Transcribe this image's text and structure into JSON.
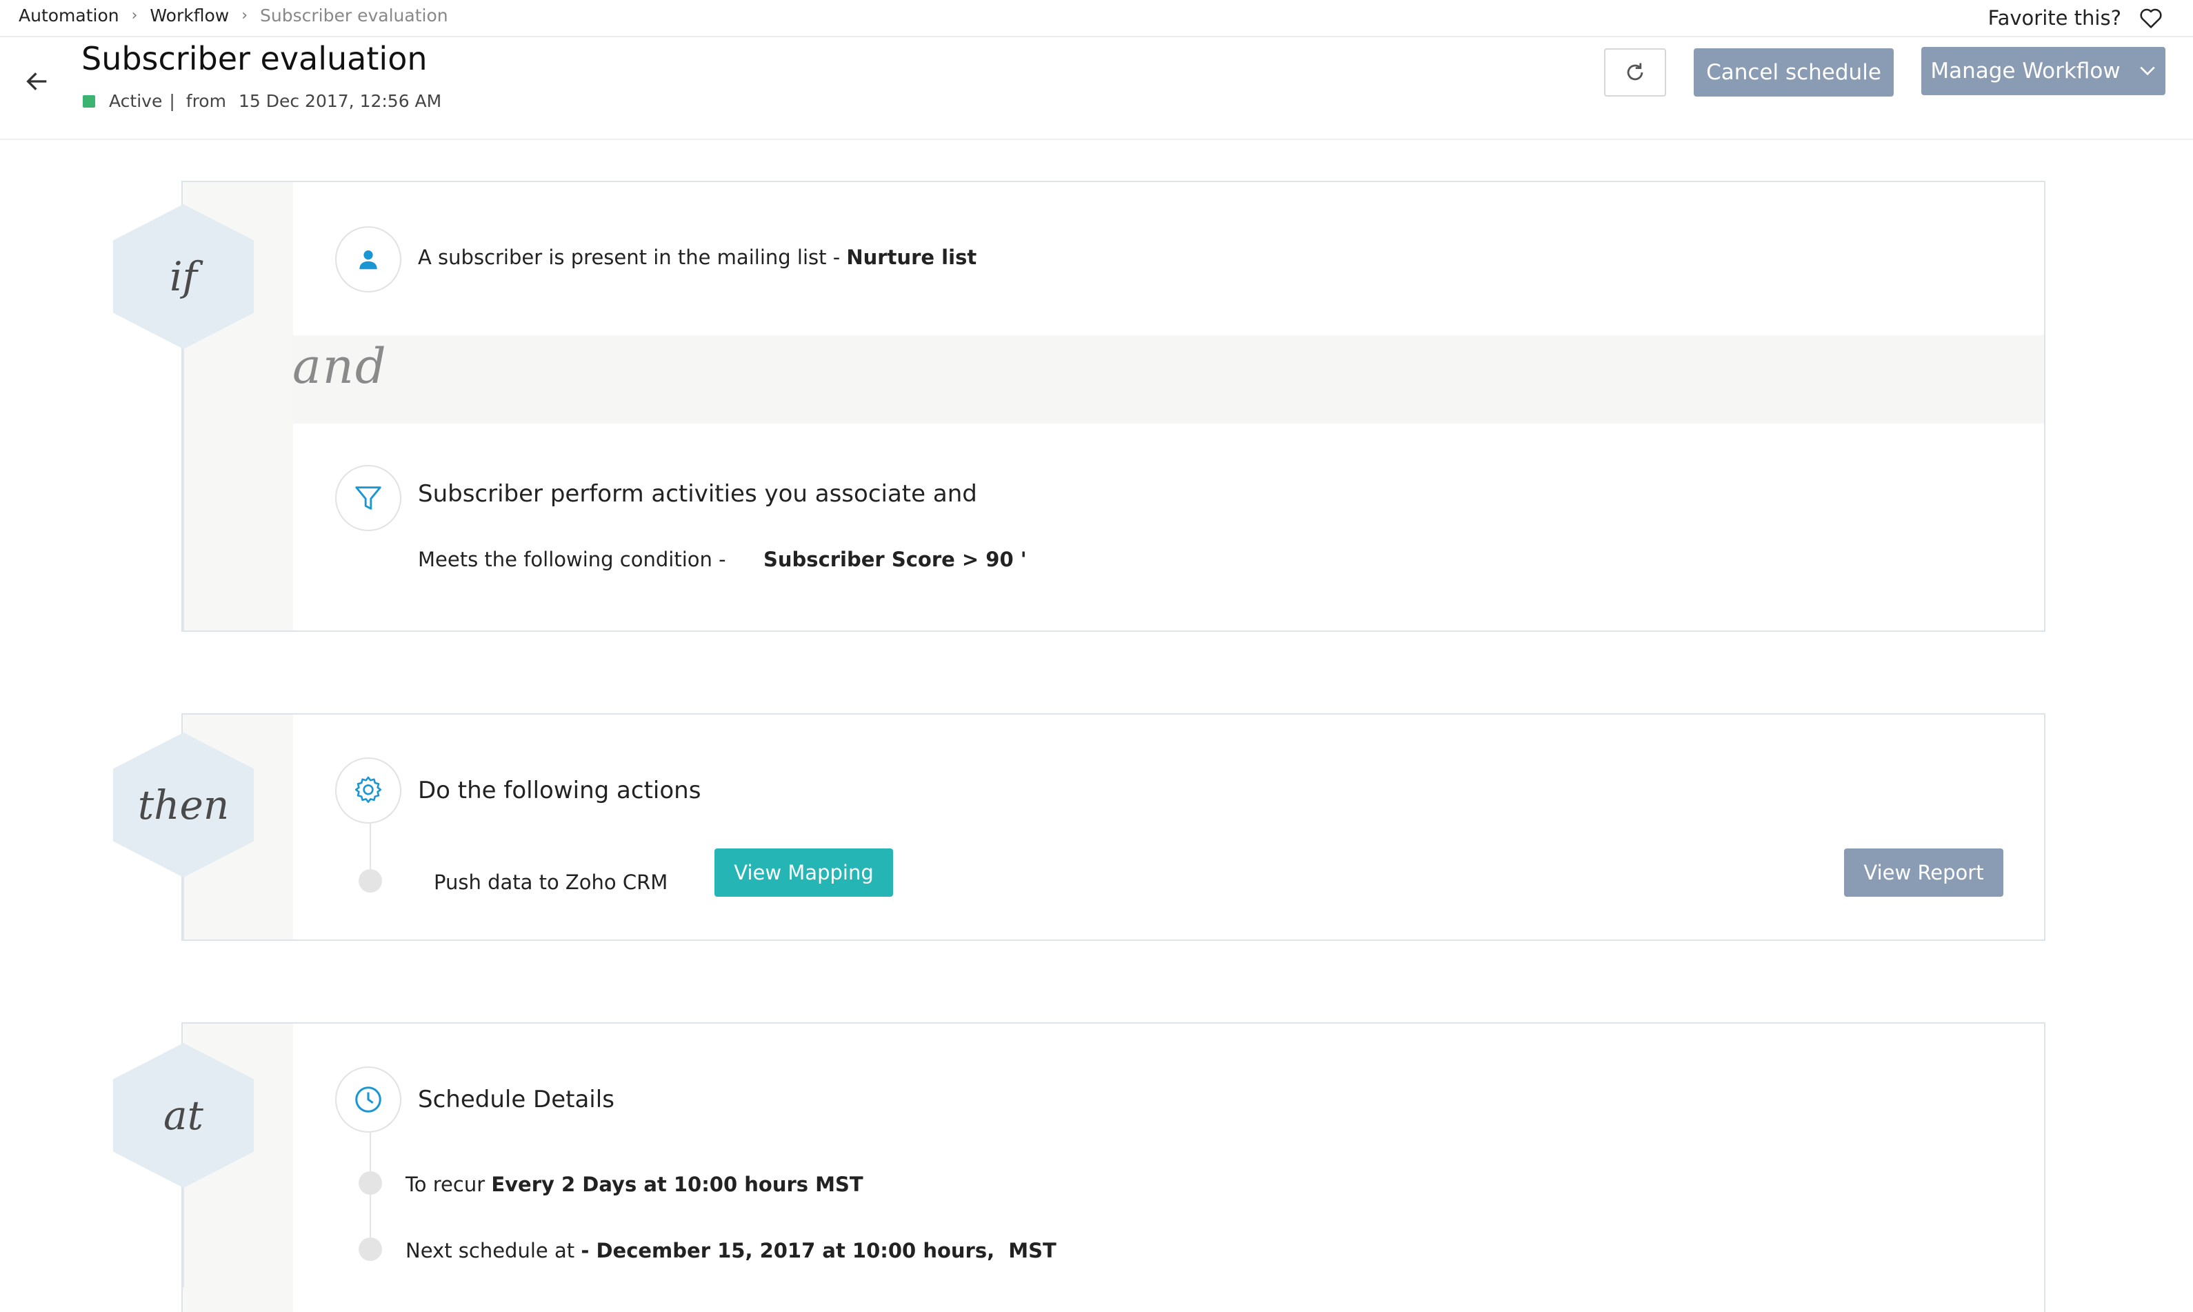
{
  "breadcrumb": {
    "items": [
      "Automation",
      "Workflow",
      "Subscriber evaluation"
    ],
    "separator": "›"
  },
  "favorite": {
    "label": "Favorite this?",
    "icon": "heart-icon"
  },
  "header": {
    "title": "Subscriber evaluation",
    "status": "Active",
    "status_color": "#3cb371",
    "pipe": "|",
    "from_label": "from",
    "from_date": "15 Dec 2017, 12:56 AM"
  },
  "buttons": {
    "refresh_icon": "refresh-icon",
    "cancel_schedule": "Cancel schedule",
    "manage_workflow": "Manage Workflow"
  },
  "if_section": {
    "badge": "if",
    "condition": {
      "icon": "user-icon",
      "text": "A subscriber is present in the mailing list - ",
      "list_name": "Nurture list"
    },
    "joiner": "and",
    "activity": {
      "icon": "filter-icon",
      "title": "Subscriber perform activities you associate and",
      "meets_label": "Meets the following condition -",
      "criteria_field": "Subscriber Score",
      "criteria_rest": " > 90 '"
    }
  },
  "then_section": {
    "badge": "then",
    "icon": "gear-icon",
    "title": "Do the following actions",
    "action": "Push data to Zoho CRM",
    "view_mapping": "View Mapping",
    "view_report": "View Report"
  },
  "at_section": {
    "badge": "at",
    "icon": "clock-icon",
    "title": "Schedule Details",
    "recur_label": "To recur ",
    "recur_value": "Every 2 Days at 10:00 hours MST",
    "next_label": "Next schedule at ",
    "next_value": "- December 15, 2017 at 10:00 hours,  MST"
  },
  "colors": {
    "accent_teal": "#26b5b5",
    "button_gray_blue": "#8a9bb4",
    "icon_blue": "#1a96d4",
    "hex_bg": "#e3ecf2"
  }
}
